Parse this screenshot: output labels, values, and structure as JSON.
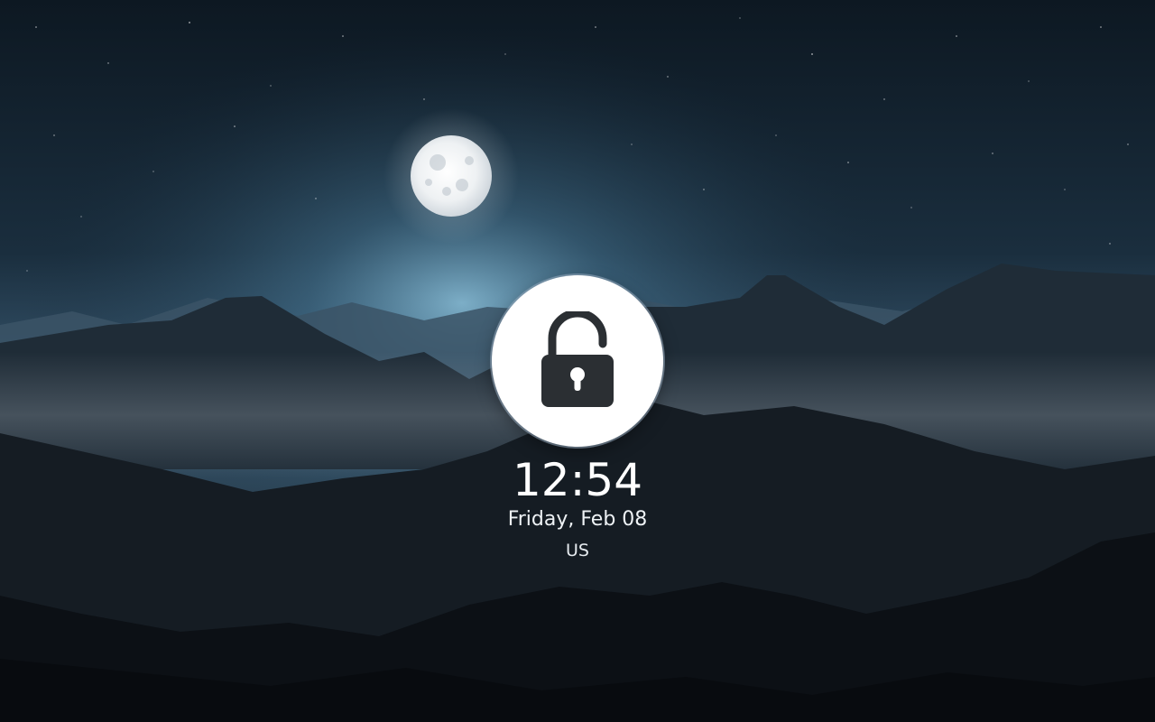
{
  "lockscreen": {
    "time": "12:54",
    "date": "Friday, Feb 08",
    "keyboard_layout": "US",
    "lock_icon": "padlock-open-icon",
    "wallpaper": "moonlit-mountain-landscape"
  },
  "colors": {
    "sky_top": "#0e1a24",
    "glow": "#6f9fba",
    "lock_circle": "#ffffff",
    "lock_glyph": "#2b2f33",
    "text": "#ffffff"
  }
}
